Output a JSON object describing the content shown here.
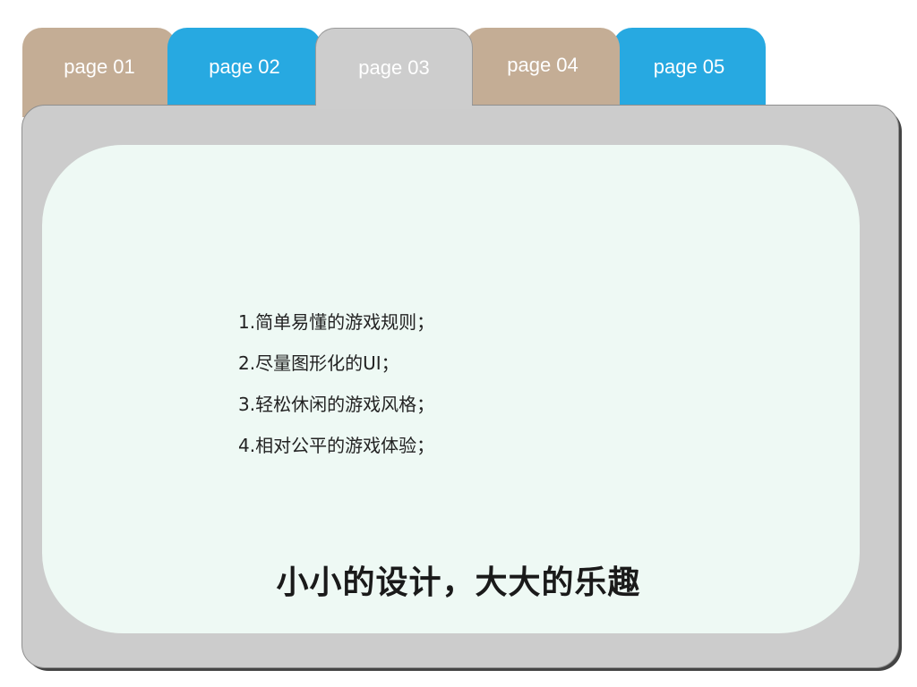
{
  "tabs": [
    {
      "label": "page 01",
      "color": "#c4ad95"
    },
    {
      "label": "page 02",
      "color": "#27a9e1"
    },
    {
      "label": "page 03",
      "color": "#cdcdcd",
      "active": true
    },
    {
      "label": "page 04",
      "color": "#c4ad95"
    },
    {
      "label": "page 05",
      "color": "#27a9e1"
    }
  ],
  "content": {
    "features": [
      "1.简单易懂的游戏规则；",
      "2.尽量图形化的UI；",
      "3.轻松休闲的游戏风格；",
      "4.相对公平的游戏体验；"
    ],
    "slogan": "小小的设计，大大的乐趣"
  },
  "colors": {
    "panel": "#cccccc",
    "card": "#eef9f4",
    "tab_tan": "#c4ad95",
    "tab_blue": "#27a9e1"
  }
}
